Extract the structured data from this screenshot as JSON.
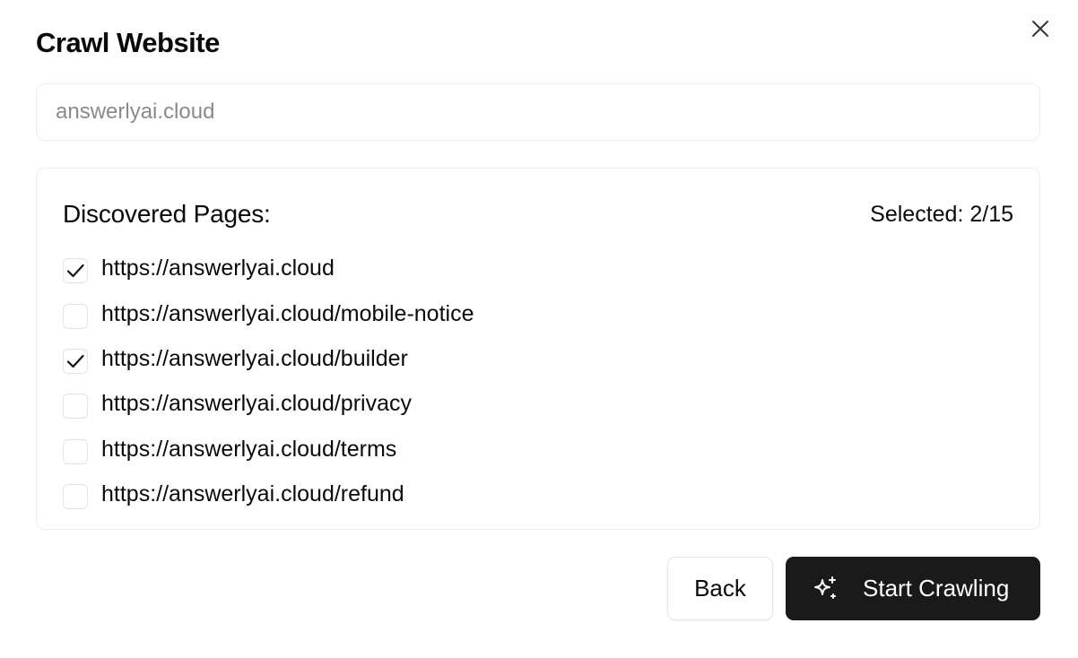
{
  "dialog": {
    "title": "Crawl Website",
    "close_icon": "close-icon"
  },
  "url_input": {
    "placeholder": "answerlyai.cloud",
    "value": ""
  },
  "pages": {
    "heading": "Discovered Pages:",
    "selected_label": "Selected: 2/15",
    "items": [
      {
        "url": "https://answerlyai.cloud",
        "checked": true
      },
      {
        "url": "https://answerlyai.cloud/mobile-notice",
        "checked": false
      },
      {
        "url": "https://answerlyai.cloud/builder",
        "checked": true
      },
      {
        "url": "https://answerlyai.cloud/privacy",
        "checked": false
      },
      {
        "url": "https://answerlyai.cloud/terms",
        "checked": false
      },
      {
        "url": "https://answerlyai.cloud/refund",
        "checked": false
      }
    ]
  },
  "actions": {
    "back_label": "Back",
    "start_label": "Start Crawling",
    "start_icon": "sparkle-icon"
  },
  "colors": {
    "primary_button": "#1a1a1a",
    "border": "#ececec",
    "text": "#0a0a0a",
    "placeholder": "#8a8a8a"
  }
}
